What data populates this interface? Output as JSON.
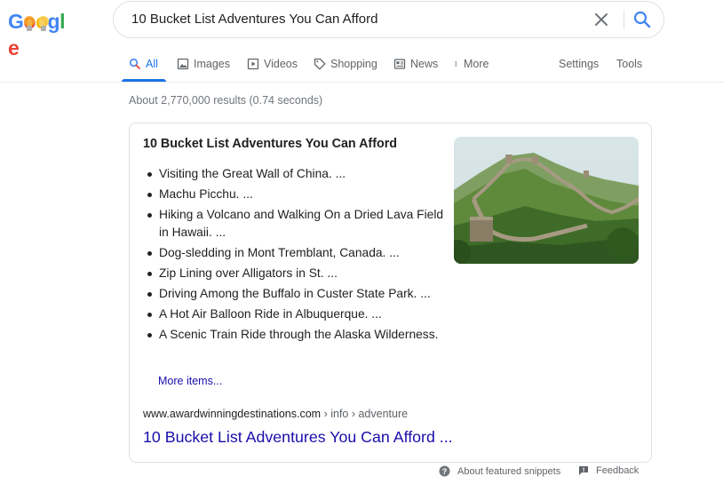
{
  "logo": {
    "text": "Google",
    "letters": [
      "G",
      "o",
      "o",
      "g",
      "l",
      "e"
    ]
  },
  "search": {
    "query": "10 Bucket List Adventures You Can Afford"
  },
  "tabs": [
    {
      "label": "All",
      "icon": "search-icon",
      "active": true
    },
    {
      "label": "Images",
      "icon": "image-icon"
    },
    {
      "label": "Videos",
      "icon": "video-icon"
    },
    {
      "label": "Shopping",
      "icon": "tag-icon"
    },
    {
      "label": "News",
      "icon": "news-icon"
    },
    {
      "label": "More",
      "icon": "more-vertical-icon"
    }
  ],
  "tools": {
    "settings": "Settings",
    "tools": "Tools"
  },
  "stats": "About 2,770,000 results (0.74 seconds)",
  "snippet": {
    "title": "10 Bucket List Adventures You Can Afford",
    "items": [
      "Visiting the Great Wall of China. ...",
      "Machu Picchu. ...",
      "Hiking a Volcano and Walking On a Dried Lava Field in Hawaii. ...",
      "Dog-sledding in Mont Tremblant, Canada. ...",
      "Zip Lining over Alligators in St. ...",
      "Driving Among the Buffalo in Custer State Park. ...",
      "A Hot Air Balloon Ride in Albuquerque. ...",
      "A Scenic Train Ride through the Alaska Wilderness."
    ],
    "more_items": "More items...",
    "cite_domain": "www.awardwinningdestinations.com",
    "cite_path": " › info › adventure",
    "link_title": "10 Bucket List Adventures You Can Afford ..."
  },
  "footer": {
    "about": "About featured snippets",
    "feedback": "Feedback"
  },
  "colors": {
    "link": "#1a0dab",
    "accent": "#1a73e8",
    "muted": "#70757a"
  }
}
